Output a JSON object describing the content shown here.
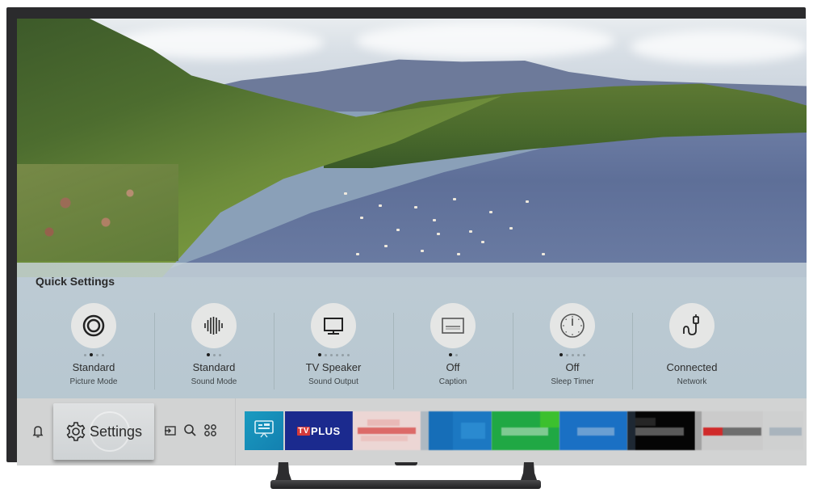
{
  "quick_settings": {
    "title": "Quick Settings",
    "items": [
      {
        "icon": "picture-mode-icon",
        "value": "Standard",
        "label": "Picture Mode",
        "dots": 4,
        "active_dot": 1
      },
      {
        "icon": "sound-mode-icon",
        "value": "Standard",
        "label": "Sound Mode",
        "dots": 3,
        "active_dot": 0
      },
      {
        "icon": "tv-speaker-icon",
        "value": "TV Speaker",
        "label": "Sound Output",
        "dots": 6,
        "active_dot": 0
      },
      {
        "icon": "caption-icon",
        "value": "Off",
        "label": "Caption",
        "dots": 2,
        "active_dot": 0
      },
      {
        "icon": "sleep-timer-icon",
        "value": "Off",
        "label": "Sleep Timer",
        "dots": 5,
        "active_dot": 0
      },
      {
        "icon": "network-icon",
        "value": "Connected",
        "label": "Network",
        "dots": 0,
        "active_dot": -1
      }
    ]
  },
  "launcher": {
    "notifications_icon": "bell-icon",
    "settings_label": "Settings",
    "source_icon": "source-icon",
    "search_icon": "search-icon",
    "apps_icon": "apps-icon",
    "apps": [
      {
        "name": "guide",
        "icon": "tv-guide-icon",
        "color": "#1a9bc0"
      },
      {
        "name": "samsung-tv-plus",
        "label_prefix": "TV",
        "label": "PLUS",
        "color": "#1b2a8e"
      },
      {
        "name": "blurred-app-1",
        "color": "#e8a8a6"
      },
      {
        "name": "blurred-app-2",
        "color": "#1c78c2"
      },
      {
        "name": "blurred-app-3",
        "color": "#20a844"
      },
      {
        "name": "blurred-app-4",
        "color": "#1a70c4"
      },
      {
        "name": "blurred-app-5",
        "color": "#0a0a0a"
      },
      {
        "name": "blurred-app-6",
        "color": "#c8c8c8"
      },
      {
        "name": "blurred-app-7",
        "color": "#c8cfd6"
      }
    ]
  }
}
